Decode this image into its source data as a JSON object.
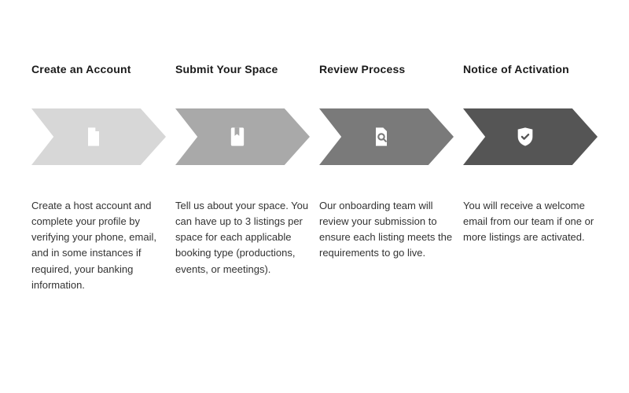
{
  "steps": [
    {
      "title": "Create an Account",
      "desc": "Create a host account and complete your profile by verifying your phone, email, and in some instances if required, your banking information.",
      "color": "#d7d7d7",
      "icon": "document-icon"
    },
    {
      "title": "Submit Your Space",
      "desc": "Tell us about your space. You can have up to 3 listings per space for each applicable booking type (productions, events, or meetings).",
      "color": "#a9a9a9",
      "icon": "bookmark-icon"
    },
    {
      "title": "Review Process",
      "desc": "Our onboarding team will review your submission to ensure each listing meets the requirements to go live.",
      "color": "#7a7a7a",
      "icon": "magnify-doc-icon"
    },
    {
      "title": "Notice of Activation",
      "desc": "You will receive a welcome email from our team if one or more listings are activated.",
      "color": "#555555",
      "icon": "shield-check-icon"
    }
  ]
}
